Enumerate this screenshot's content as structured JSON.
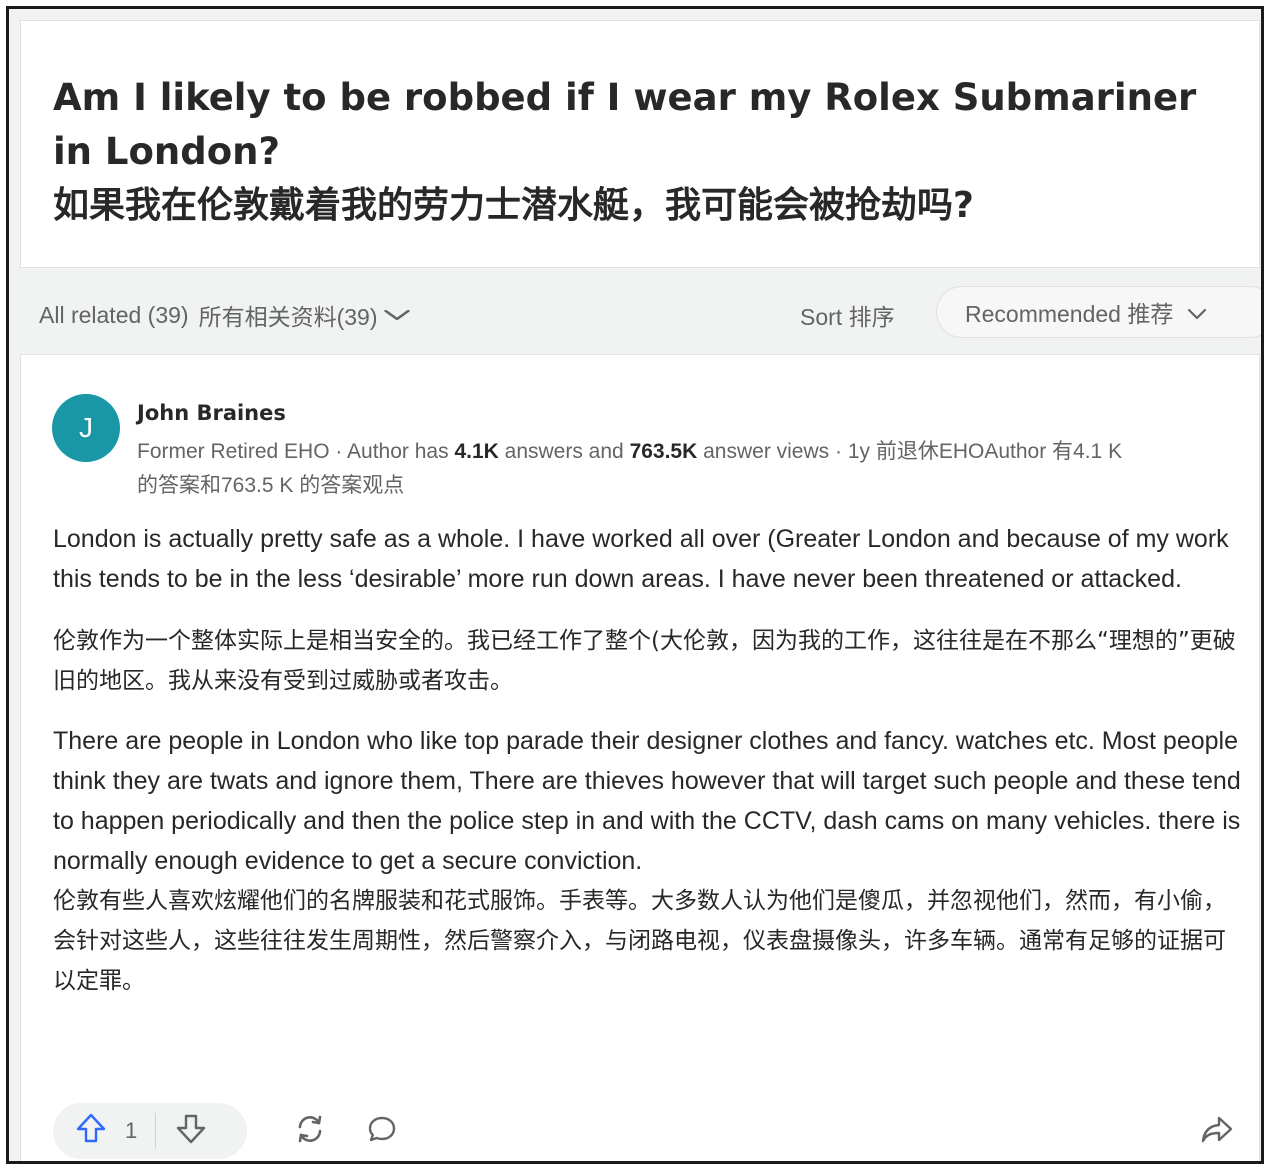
{
  "question": {
    "title_en": "Am I likely to be robbed if I wear my Rolex Submariner in London?",
    "title_cn": "如果我在伦敦戴着我的劳力士潜水艇，我可能会被抢劫吗?"
  },
  "filter": {
    "all_related": "All related (39)",
    "all_related_cn": "所有相关资料(39)",
    "sort_label": "Sort  排序",
    "sort_value": "Recommended  推荐"
  },
  "answer": {
    "author": {
      "avatar_letter": "J",
      "name": "John Braines",
      "meta_prefix": "Former Retired EHO · Author has ",
      "answers_count": "4.1K",
      "meta_mid": " answers and ",
      "views_count": "763.5K",
      "meta_suffix": " answer views · 1y  前退休EHOAuthor 有4.1 K 的答案和763.5 K 的答案观点"
    },
    "paragraphs": {
      "p1_en": "London is actually pretty safe as a whole. I have worked all over (Greater London and because of my work this tends to be in the less ‘desirable’ more run down areas. I have never been threatened or attacked.",
      "p1_cn": "伦敦作为一个整体实际上是相当安全的。我已经工作了整个(大伦敦，因为我的工作，这往往是在不那么“理想的”更破旧的地区。我从来没有受到过威胁或者攻击。",
      "p2_en": "There are people in London who like top parade their designer clothes and fancy. watches etc. Most people think they are twats and ignore them, There are thieves however that will target such people and these tend to happen periodically and then the police step in and with the CCTV, dash cams on many vehicles. there is normally enough evidence to get a secure conviction.",
      "p2_cn": "伦敦有些人喜欢炫耀他们的名牌服装和花式服饰。手表等。大多数人认为他们是傻瓜，并忽视他们，然而，有小偷，会针对这些人，这些往往发生周期性，然后警察介入，与闭路电视，仪表盘摄像头，许多车辆。通常有足够的证据可以定罪。"
    },
    "actions": {
      "upvote_count": "1"
    }
  },
  "colors": {
    "accent_blue": "#2e69ff",
    "avatar_teal": "#1a97a7",
    "text_secondary": "#636466"
  },
  "icons": [
    "upvote-icon",
    "downvote-icon",
    "share-repost-icon",
    "comment-icon",
    "share-arrow-icon",
    "chevron-down-icon"
  ]
}
